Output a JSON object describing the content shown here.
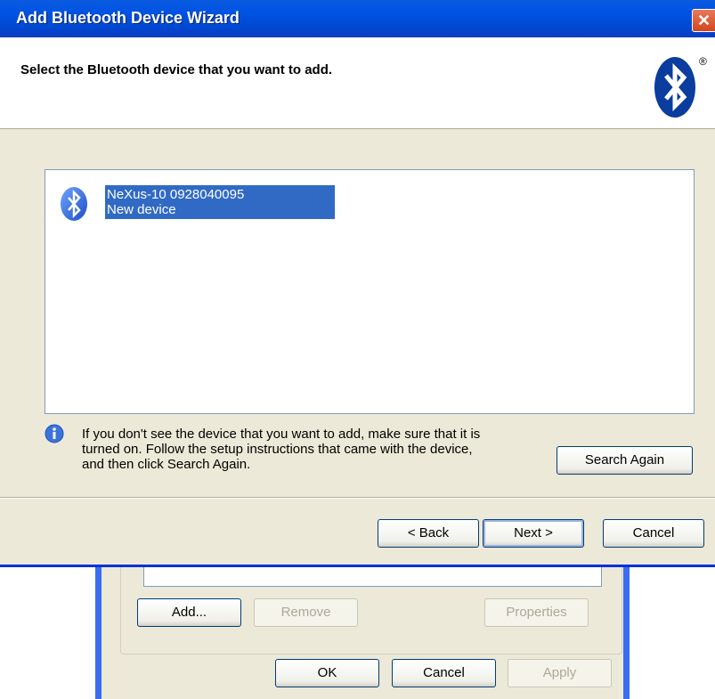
{
  "wizard": {
    "title": "Add Bluetooth Device Wizard",
    "close_label": "✕",
    "header_title": "Select the Bluetooth device that you want to add.",
    "registered_mark": "®",
    "device": {
      "name": "NeXus-10 0928040095",
      "status": "New device"
    },
    "info_text_lines": [
      "If you don't see the device that you want to add, make sure that it is",
      "turned on. Follow the setup instructions that came with the device,",
      "and then click Search Again."
    ],
    "search_again_label": "Search Again",
    "back_label": "< Back",
    "next_label": "Next >",
    "cancel_label": "Cancel"
  },
  "background_window": {
    "add_label": "Add...",
    "remove_label": "Remove",
    "properties_label": "Properties",
    "ok_label": "OK",
    "cancel_label": "Cancel",
    "apply_label": "Apply"
  },
  "colors": {
    "titlebar": "#0054e3",
    "selection": "#316ac5",
    "dialog_bg": "#ece9d8",
    "close_button": "#d4471f"
  },
  "icons": {
    "logo": "bluetooth-logo-icon",
    "device": "bluetooth-device-icon",
    "info": "info-icon"
  }
}
